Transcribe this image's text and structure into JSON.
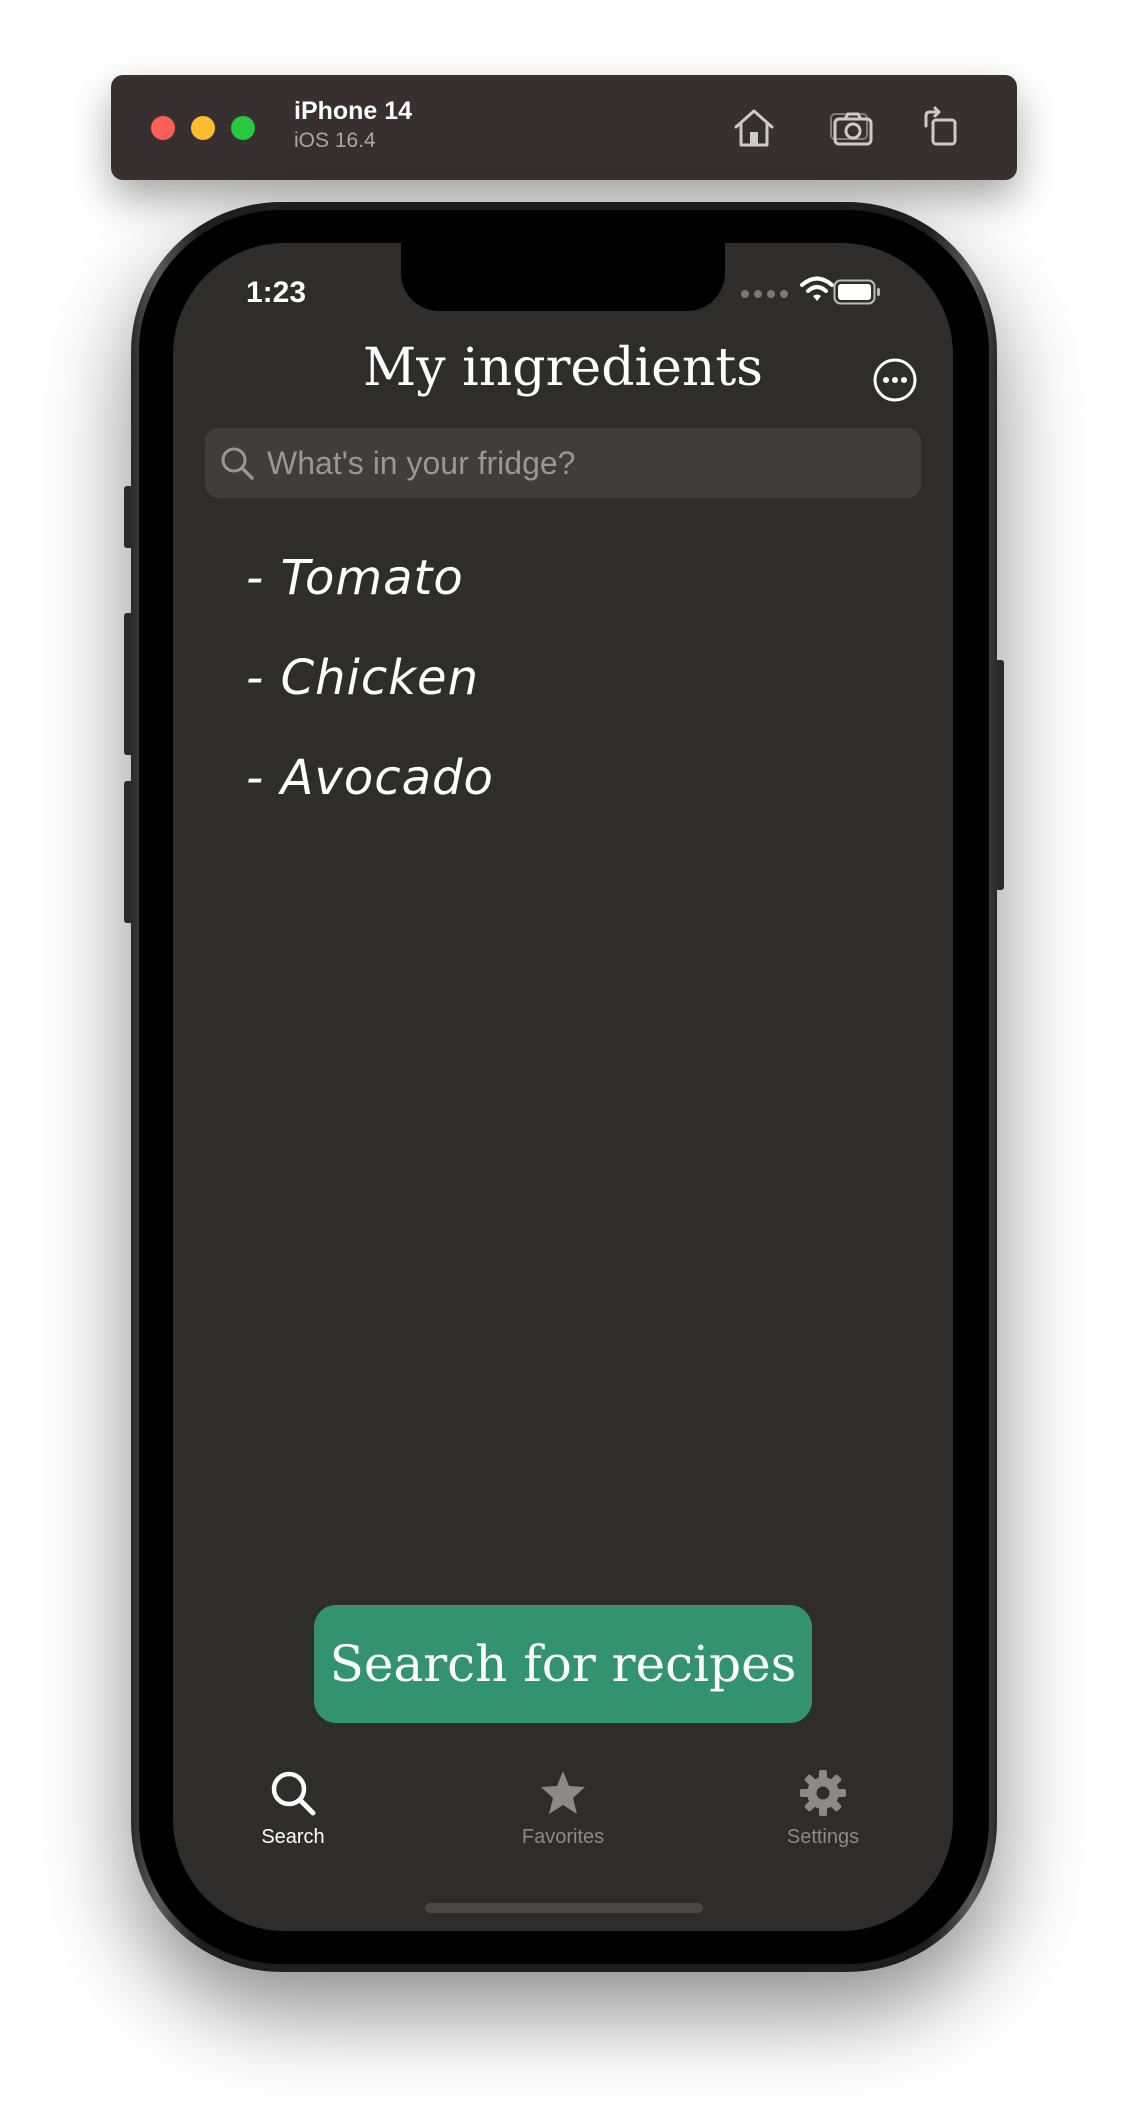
{
  "simulator": {
    "device_name": "iPhone 14",
    "os_version": "iOS 16.4",
    "toolbar_icons": [
      "home-icon",
      "screenshot-icon",
      "rotate-icon"
    ]
  },
  "status_bar": {
    "time": "1:23",
    "icons": [
      "cellular-icon",
      "wifi-icon",
      "battery-icon"
    ]
  },
  "header": {
    "title": "My ingredients",
    "more_icon": "ellipsis-circle-icon"
  },
  "search": {
    "placeholder": "What's in your fridge?",
    "value": ""
  },
  "ingredients": [
    "- Tomato",
    "- Chicken",
    "- Avocado"
  ],
  "cta": {
    "label": "Search for recipes"
  },
  "tab_bar": {
    "selected": "Search",
    "tabs": [
      {
        "label": "Search",
        "icon": "magnifier-icon"
      },
      {
        "label": "Favorites",
        "icon": "star-icon"
      },
      {
        "label": "Settings",
        "icon": "gear-icon"
      }
    ]
  },
  "colors": {
    "screen_background": "#2f2d2c",
    "accent": "#33926f",
    "search_field": "#403d3d",
    "inactive_tab": "#8c8989"
  }
}
